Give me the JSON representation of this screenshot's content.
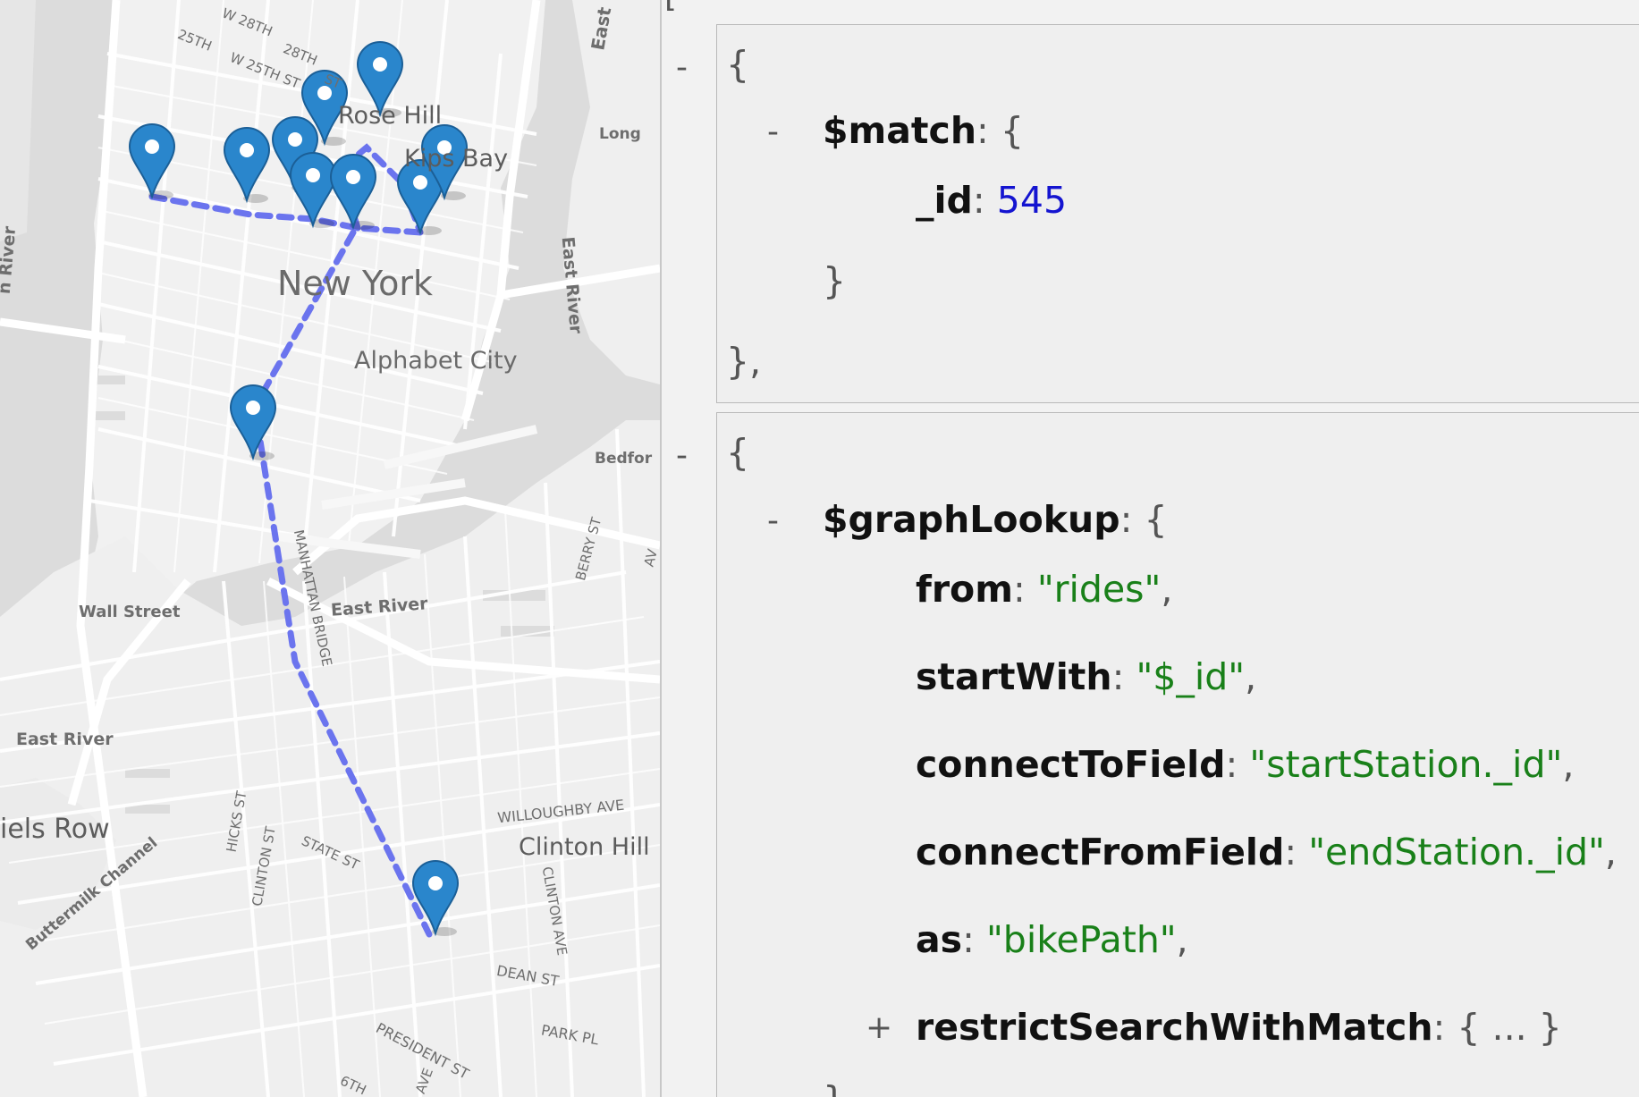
{
  "map": {
    "labels": {
      "w28th": "W 28TH",
      "s28th": "28TH",
      "w25th_a": "25TH",
      "w25th_b": "W 25TH ST",
      "st": "ST",
      "rose_hill": "Rose Hill",
      "kips_bay": "Kips Bay",
      "east_top": "East",
      "long": "Long",
      "river_left": "n River",
      "new_york": "New York",
      "alphabet_city": "Alphabet City",
      "east_river_vertical": "East River",
      "bedford": "Bedfor",
      "berry_st": "BERRY ST",
      "av": "AV",
      "wall_street": "Wall Street",
      "east_river_mid": "East River",
      "manhattan_bridge": "MANHATTAN BRIDGE",
      "east_river_left": "East River",
      "willoughby": "WILLOUGHBY AVE",
      "clinton_hill": "Clinton Hill",
      "clinton_ave": "CLINTON AVE",
      "hicks_st": "HICKS ST",
      "clinton_st": "CLINTON ST",
      "state_st": "STATE ST",
      "daniels_row": "iels Row",
      "buttermilk": "Buttermilk Channel",
      "dean_st": "DEAN ST",
      "park_pl": "PARK PL",
      "president_st": "PRESIDENT ST",
      "sixth": "6TH",
      "ave": "AVE"
    },
    "marker_count": 11,
    "route_color": "#6b74ee",
    "marker_color": "#2a86cc"
  },
  "code": {
    "stage1": {
      "toggle": "-",
      "open": "{",
      "op_toggle": "-",
      "op": "$match",
      "op_open": "{",
      "id_key": "_id",
      "id_val": "545",
      "op_close": "}",
      "close": "},"
    },
    "stage2": {
      "toggle": "-",
      "open": "{",
      "op_toggle": "-",
      "op": "$graphLookup",
      "op_open": "{",
      "fields": [
        {
          "key": "from",
          "value": "\"rides\"",
          "sep": ","
        },
        {
          "key": "startWith",
          "value": "\"$_id\"",
          "sep": ","
        },
        {
          "key": "connectToField",
          "value": "\"startStation._id\"",
          "sep": ","
        },
        {
          "key": "connectFromField",
          "value": "\"endStation._id\"",
          "sep": ","
        },
        {
          "key": "as",
          "value": "\"bikePath\"",
          "sep": ","
        }
      ],
      "restrict_toggle": "+",
      "restrict_key": "restrictSearchWithMatch",
      "restrict_value": "{ ... }",
      "op_close": "}"
    },
    "colon": ":",
    "top_bracket": "["
  }
}
